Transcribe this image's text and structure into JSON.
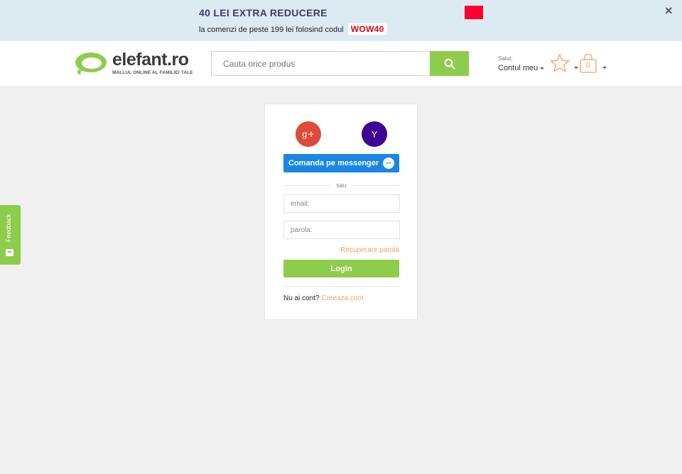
{
  "promo": {
    "title": "40 LEI EXTRA REDUCERE",
    "subtitle": "la comenzi de peste 199 lei folosind codul",
    "code": "WOW40",
    "close": "×",
    "accent_color": "#ff0033"
  },
  "header": {
    "logo_text": "elefant.ro",
    "logo_tagline": "MALLUL ONLINE AL FAMILIEI TALE",
    "search_placeholder": "Cauta orice produs",
    "greeting": "Salut,",
    "account_label": "Contul meu",
    "cart_count": "0",
    "brand_color": "#8ecc4c"
  },
  "feedback": {
    "label": "Feedback"
  },
  "login": {
    "google_label": "g+",
    "yahoo_label": "Y",
    "messenger_label": "Comanda pe messenger",
    "separator": "sau",
    "email_placeholder": "email:",
    "password_placeholder": "parola:",
    "recover_label": "Recuperare parola",
    "login_button": "Login",
    "no_account_text": "Nu ai cont?",
    "create_account_link": "Creeaza cont"
  }
}
